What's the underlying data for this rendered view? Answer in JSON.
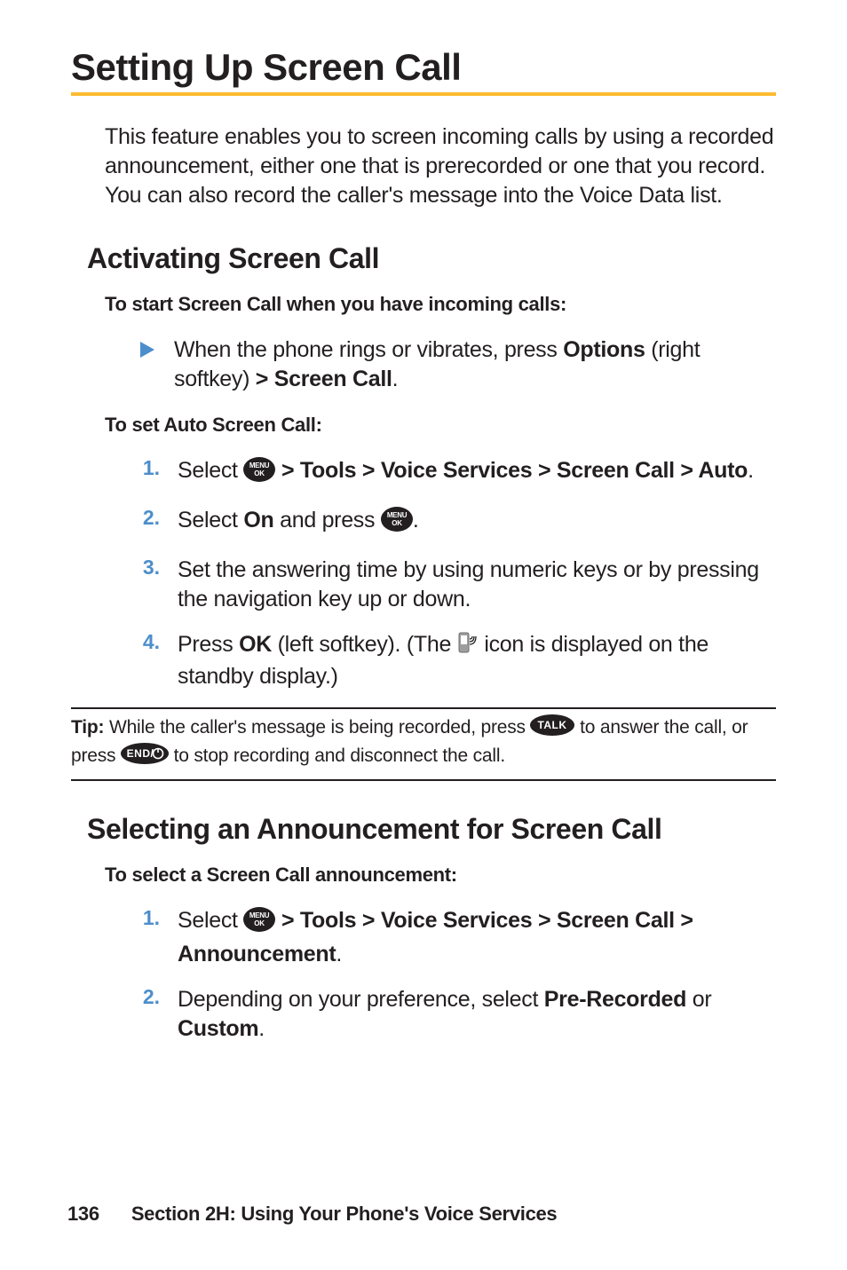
{
  "title": "Setting Up Screen Call",
  "intro": "This feature enables you to screen incoming calls by using a recorded announcement, either one that is prerecorded or one that you record. You can also record the caller's message into the Voice Data list.",
  "section1": {
    "heading": "Activating Screen Call",
    "lead1": "To start Screen Call when you have incoming calls:",
    "bullet": {
      "pre": "When the phone rings or vibrates, press ",
      "options": "Options",
      "mid": " (right softkey) ",
      "path": "> Screen Call",
      "post": "."
    },
    "lead2": "To set Auto Screen Call:",
    "steps": {
      "s1": {
        "num": "1.",
        "pre": "Select ",
        "path": " > Tools > Voice Services > Screen Call > Auto",
        "post": "."
      },
      "s2": {
        "num": "2.",
        "pre": "Select ",
        "on": "On",
        "mid": " and press ",
        "post": "."
      },
      "s3": {
        "num": "3.",
        "text": "Set the answering time by using numeric keys or by pressing the navigation key up or down."
      },
      "s4": {
        "num": "4.",
        "pre": "Press ",
        "ok": "OK",
        "mid1": " (left softkey). (The ",
        "mid2": " icon is displayed on the standby display.)"
      }
    }
  },
  "tip": {
    "label": "Tip: ",
    "part1": "While the caller's message is being recorded, press ",
    "part2": " to answer the call, or press ",
    "part3": " to stop recording and disconnect the call."
  },
  "section2": {
    "heading": "Selecting an Announcement for Screen Call",
    "lead": "To select a Screen Call announcement:",
    "steps": {
      "s1": {
        "num": "1.",
        "pre": "Select ",
        "path": " > Tools > Voice Services > Screen Call > Announcement",
        "post": "."
      },
      "s2": {
        "num": "2.",
        "pre": "Depending on your preference, select ",
        "opt1": "Pre-Recorded",
        "mid": " or ",
        "opt2": "Custom",
        "post": "."
      }
    }
  },
  "footer": {
    "page": "136",
    "section": "Section 2H: Using Your Phone's Voice Services"
  },
  "icons": {
    "menu_ok": "menu-ok-icon",
    "triangle": "triangle-icon",
    "screen_call": "screen-call-icon",
    "talk": "talk-icon",
    "end": "end-icon"
  }
}
